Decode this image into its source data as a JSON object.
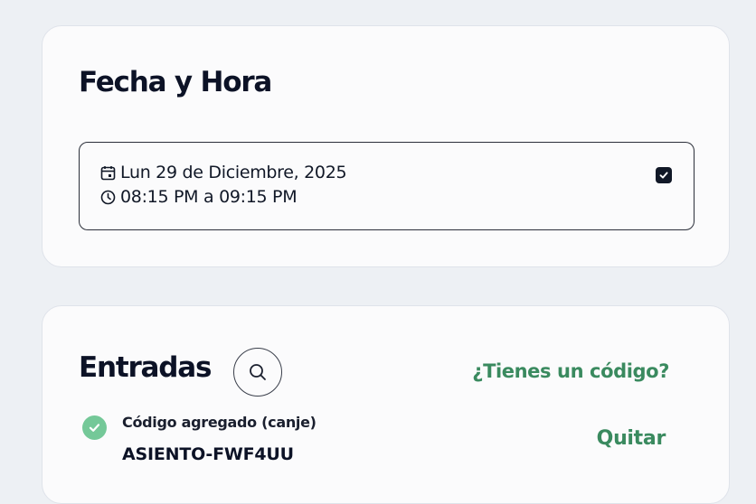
{
  "date_section": {
    "title": "Fecha y Hora",
    "date_text": "Lun 29 de Diciembre, 2025",
    "time_text": "08:15 PM a 09:15 PM",
    "selected": true
  },
  "tickets_section": {
    "title": "Entradas",
    "code_link": "¿Tienes un código?",
    "applied_code": {
      "label": "Código agregado (canje)",
      "value": "ASIENTO-FWF4UU",
      "remove_label": "Quitar"
    }
  },
  "colors": {
    "accent_green": "#3a8a5f",
    "success_green": "#74c898",
    "text_dark": "#0c1226"
  }
}
